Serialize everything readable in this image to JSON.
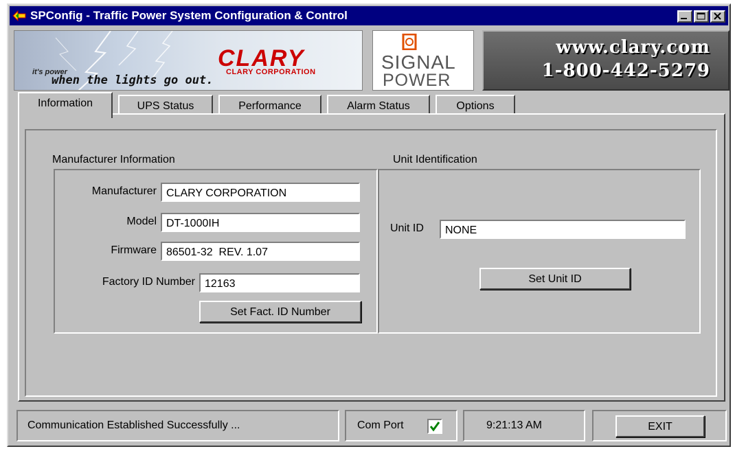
{
  "window": {
    "title": "SPConfig - Traffic Power System Configuration & Control"
  },
  "banner": {
    "slogan_small": "it's power",
    "slogan_main": "when the lights go out.",
    "clary_logo_text": "CLARY",
    "clary_corporation": "CLARY CORPORATION",
    "signal_top": "SIGNAL",
    "signal_bottom": "POWER",
    "website": "www.clary.com",
    "phone": "1-800-442-5279"
  },
  "tabs": [
    {
      "label": "Information",
      "active": true
    },
    {
      "label": "UPS Status",
      "active": false
    },
    {
      "label": "Performance",
      "active": false
    },
    {
      "label": "Alarm Status",
      "active": false
    },
    {
      "label": "Options",
      "active": false
    }
  ],
  "manufacturer_info": {
    "group_label": "Manufacturer Information",
    "manufacturer_label": "Manufacturer",
    "manufacturer_value": "CLARY CORPORATION",
    "model_label": "Model",
    "model_value": "DT-1000IH",
    "firmware_label": "Firmware",
    "firmware_value": "86501-32  REV. 1.07",
    "factory_id_label": "Factory ID Number",
    "factory_id_value": "12163",
    "set_factory_id_button": "Set Fact. ID Number"
  },
  "unit_identification": {
    "group_label": "Unit Identification",
    "unit_id_label": "Unit ID",
    "unit_id_value": "NONE",
    "set_unit_id_button": "Set Unit ID"
  },
  "status_bar": {
    "message": "Communication Established Successfully ...",
    "com_port_label": "Com Port",
    "com_port_checked": true,
    "time": "9:21:13 AM",
    "exit_button": "EXIT"
  },
  "colors": {
    "titlebar": "#000080",
    "face": "#c0c0c0",
    "clary_red": "#cc0000",
    "check_green": "#008000"
  }
}
